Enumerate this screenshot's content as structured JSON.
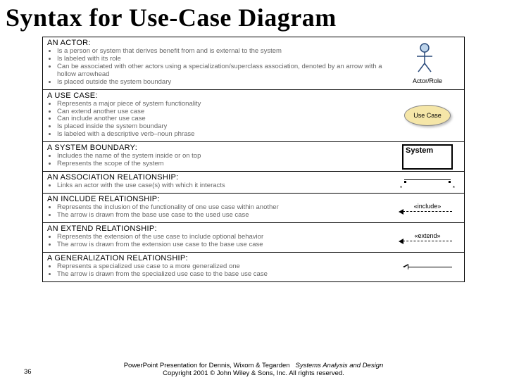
{
  "title": "Syntax for Use-Case Diagram",
  "sections": [
    {
      "heading": "AN ACTOR:",
      "bullets": [
        "Is a person or system that derives benefit from and is external to the system",
        "Is labeled with its role",
        "Can be associated with other actors using a specialization/superclass association, denoted by an arrow with a hollow arrowhead",
        "Is placed outside the system boundary"
      ],
      "icon_label": "Actor/Role"
    },
    {
      "heading": "A USE CASE:",
      "bullets": [
        "Represents a major piece of system functionality",
        "Can extend another use case",
        "Can include another use case",
        "Is placed inside the system boundary",
        "Is labeled with a descriptive verb–noun phrase"
      ],
      "icon_label": "Use Case"
    },
    {
      "heading": "A SYSTEM BOUNDARY:",
      "bullets": [
        "Includes the name of the system inside or on top",
        "Represents the scope of the system"
      ],
      "icon_label": "System"
    },
    {
      "heading": "AN ASSOCIATION RELATIONSHIP:",
      "bullets": [
        "Links an actor with the use case(s) with which it interacts"
      ]
    },
    {
      "heading": "AN INCLUDE RELATIONSHIP:",
      "bullets": [
        "Represents the inclusion of the functionality of one use case within another",
        "The arrow is drawn from the base use case to the used use case"
      ],
      "icon_label": "«include»"
    },
    {
      "heading": "AN EXTEND RELATIONSHIP:",
      "bullets": [
        "Represents the extension of the use case to include optional behavior",
        "The arrow is drawn from the extension use case to the base use case"
      ],
      "icon_label": "«extend»"
    },
    {
      "heading": "A GENERALIZATION RELATIONSHIP:",
      "bullets": [
        "Represents a specialized use case to a more generalized one",
        "The arrow is drawn from the specialized use case to the base use case"
      ]
    }
  ],
  "footer": {
    "page": "36",
    "credit": "PowerPoint Presentation for Dennis, Wixom & Tegarden",
    "book": "Systems Analysis and Design",
    "copyright": "Copyright 2001 © John Wiley & Sons, Inc.  All rights reserved."
  }
}
